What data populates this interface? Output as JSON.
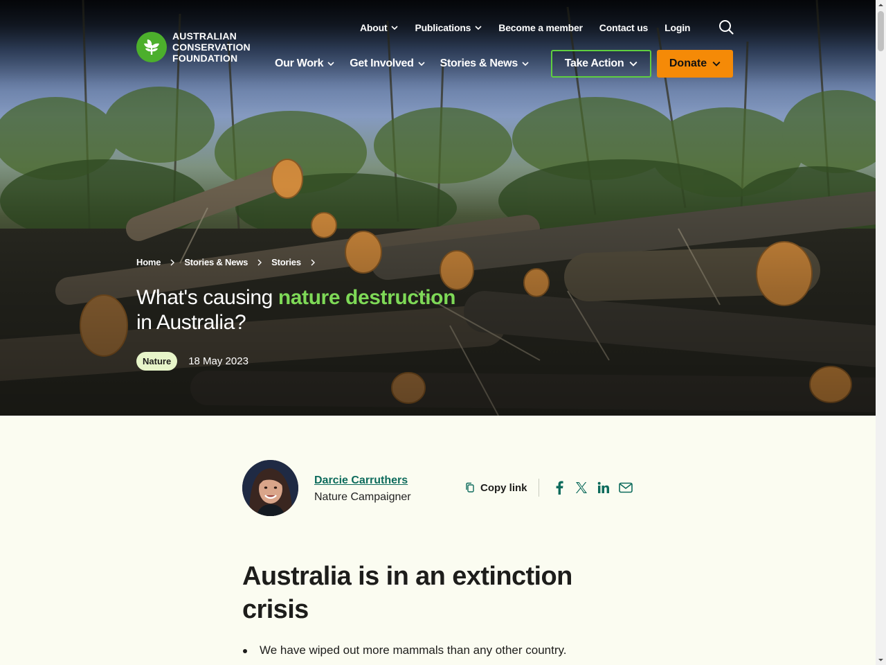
{
  "logo": {
    "lines": [
      "AUSTRALIAN",
      "CONSERVATION",
      "FOUNDATION"
    ]
  },
  "topnav": {
    "items": [
      {
        "label": "About",
        "dropdown": true
      },
      {
        "label": "Publications",
        "dropdown": true
      },
      {
        "label": "Become a member",
        "dropdown": false
      },
      {
        "label": "Contact us",
        "dropdown": false
      },
      {
        "label": "Login",
        "dropdown": false
      }
    ],
    "search_icon": "search-icon"
  },
  "mainnav": {
    "items": [
      {
        "label": "Our Work"
      },
      {
        "label": "Get Involved"
      },
      {
        "label": "Stories & News"
      }
    ],
    "take_action": "Take Action",
    "donate": "Donate"
  },
  "breadcrumb": [
    "Home",
    "Stories & News",
    "Stories"
  ],
  "hero": {
    "title_part1": "What's causing ",
    "title_highlight": "nature destruction",
    "title_part2": "in Australia?",
    "tag": "Nature",
    "date": "18 May 2023"
  },
  "author": {
    "name": "Darcie Carruthers",
    "role": "Nature Campaigner"
  },
  "share": {
    "copy_link": "Copy link",
    "icons": [
      "facebook-icon",
      "x-icon",
      "linkedin-icon",
      "email-icon"
    ]
  },
  "article": {
    "heading": "Australia is in an extinction crisis",
    "bullets": [
      "We have wiped out more mammals than any other country."
    ]
  },
  "colors": {
    "brand_green": "#4caf2c",
    "highlight_green": "#7ed957",
    "donate_orange": "#f58a07",
    "link_teal": "#0d6b5c",
    "page_bg": "#fbfcf1"
  }
}
